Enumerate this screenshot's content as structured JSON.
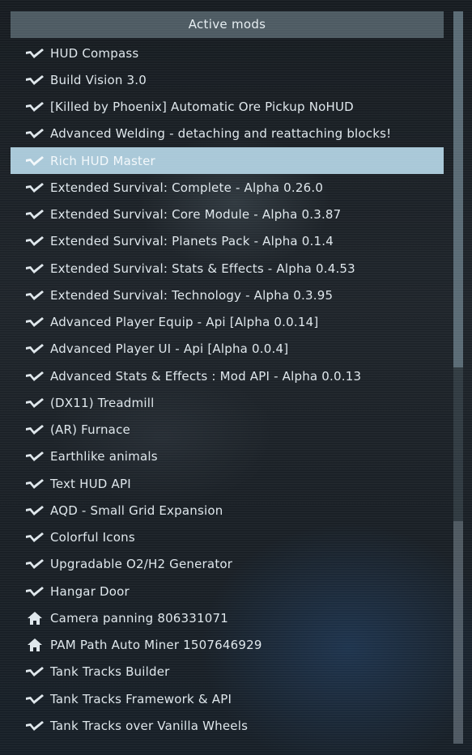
{
  "panel": {
    "title": "Active mods"
  },
  "mods": [
    {
      "label": "HUD Compass",
      "icon": "steam-workshop-icon"
    },
    {
      "label": "Build Vision 3.0",
      "icon": "steam-workshop-icon"
    },
    {
      "label": "[Killed by Phoenix] Automatic Ore Pickup NoHUD",
      "icon": "steam-workshop-icon"
    },
    {
      "label": "Advanced Welding - detaching and reattaching blocks!",
      "icon": "steam-workshop-icon"
    },
    {
      "label": "Rich HUD Master",
      "icon": "steam-workshop-icon",
      "selected": true
    },
    {
      "label": "Extended Survival: Complete - Alpha 0.26.0",
      "icon": "steam-workshop-icon"
    },
    {
      "label": "Extended Survival: Core Module - Alpha 0.3.87",
      "icon": "steam-workshop-icon"
    },
    {
      "label": "Extended Survival: Planets Pack - Alpha 0.1.4",
      "icon": "steam-workshop-icon"
    },
    {
      "label": "Extended Survival: Stats & Effects - Alpha 0.4.53",
      "icon": "steam-workshop-icon"
    },
    {
      "label": "Extended Survival: Technology - Alpha 0.3.95",
      "icon": "steam-workshop-icon"
    },
    {
      "label": "Advanced Player Equip - Api [Alpha 0.0.14]",
      "icon": "steam-workshop-icon"
    },
    {
      "label": "Advanced Player UI - Api [Alpha 0.0.4]",
      "icon": "steam-workshop-icon"
    },
    {
      "label": "Advanced Stats & Effects : Mod API - Alpha 0.0.13",
      "icon": "steam-workshop-icon"
    },
    {
      "label": "(DX11) Treadmill",
      "icon": "steam-workshop-icon"
    },
    {
      "label": "(AR) Furnace",
      "icon": "steam-workshop-icon"
    },
    {
      "label": "Earthlike animals",
      "icon": "steam-workshop-icon"
    },
    {
      "label": "Text HUD API",
      "icon": "steam-workshop-icon"
    },
    {
      "label": "AQD - Small Grid Expansion",
      "icon": "steam-workshop-icon"
    },
    {
      "label": "Colorful Icons",
      "icon": "steam-workshop-icon"
    },
    {
      "label": "Upgradable O2/H2 Generator",
      "icon": "steam-workshop-icon"
    },
    {
      "label": "Hangar Door",
      "icon": "steam-workshop-icon"
    },
    {
      "label": "Camera panning 806331071",
      "icon": "home-icon"
    },
    {
      "label": "PAM Path Auto Miner 1507646929",
      "icon": "home-icon"
    },
    {
      "label": "Tank Tracks Builder",
      "icon": "steam-workshop-icon"
    },
    {
      "label": "Tank Tracks Framework & API",
      "icon": "steam-workshop-icon"
    },
    {
      "label": "Tank Tracks over Vanilla Wheels",
      "icon": "steam-workshop-icon"
    }
  ],
  "colors": {
    "header_bg": "#4e5b63",
    "selected_bg": "#a9c8d8",
    "text": "#dfe7ec"
  }
}
